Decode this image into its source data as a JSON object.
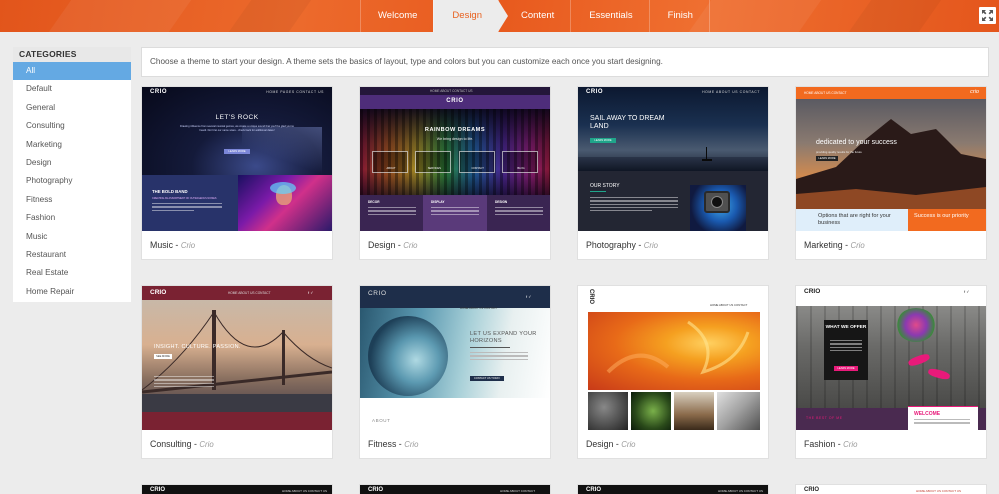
{
  "wizard": {
    "steps": [
      {
        "label": "Welcome",
        "active": false
      },
      {
        "label": "Design",
        "active": true
      },
      {
        "label": "Content",
        "active": false
      },
      {
        "label": "Essentials",
        "active": false
      },
      {
        "label": "Finish",
        "active": false
      }
    ]
  },
  "colors": {
    "accent": "#e8611f",
    "selection": "#64a9e3"
  },
  "sidebar": {
    "title": "CATEGORIES",
    "items": [
      "All",
      "Default",
      "General",
      "Consulting",
      "Marketing",
      "Design",
      "Photography",
      "Fitness",
      "Fashion",
      "Music",
      "Restaurant",
      "Real Estate",
      "Home Repair"
    ],
    "selected": "All"
  },
  "intro": "Choose a theme to start your design. A theme sets the basics of layout, type and colors but you can customize each once you start designing.",
  "themes": [
    {
      "name": "Music",
      "brand": "Crio",
      "preview": {
        "logo": "CRIO",
        "nav": "HOME   PAGES   CONTACT US",
        "headline": "LET'S ROCK",
        "sub": "Drawing influence from several musical genres, we create a unique sound that you'll be glad you've heard. Don't let our name scare - check back for additional dates!",
        "button": "LEARN MORE",
        "section": "THE BOLD BAND",
        "section_sub": "CREATING AN ASSORTMENT OF OUTRAGEOUS NOISES"
      }
    },
    {
      "name": "Design",
      "brand": "Crio",
      "preview": {
        "logo": "CRIO",
        "nav": "HOME   ABOUT   CONTACT US",
        "headline": "RAINBOW DREAMS",
        "sub": "We bring design to life.",
        "icons": [
          "ABOUT",
          "SERVICES",
          "CONTACT",
          "BLOG"
        ],
        "cols": [
          "DECOR",
          "DISPLAY",
          "DESIGN"
        ]
      }
    },
    {
      "name": "Photography",
      "brand": "Crio",
      "preview": {
        "logo": "CRIO",
        "nav": "HOME   ABOUT US   CONTACT",
        "headline": "SAIL AWAY TO DREAM LAND",
        "button": "LEARN MORE",
        "section": "OUR STORY"
      }
    },
    {
      "name": "Marketing",
      "brand": "Crio",
      "preview": {
        "logo": "crio",
        "nav": "HOME   ABOUT US   CONTACT",
        "headline": "dedicated to your success",
        "sub": "providing quality results for the future",
        "button": "LEARN MORE",
        "box_left": "Options that are right for your business",
        "box_right": "Success is our priority"
      }
    },
    {
      "name": "Consulting",
      "brand": "Crio",
      "preview": {
        "logo": "CRIO",
        "nav": "HOME   ABOUT US   CONTACT",
        "headline": "INSIGHT. CULTURE. PASSION.",
        "button": "SEE MORE"
      }
    },
    {
      "name": "Fitness",
      "brand": "Crio",
      "preview": {
        "logo": "CRIO",
        "nav": "HOME   ABOUT US   CONTACT",
        "headline": "LET US EXPAND YOUR HORIZONS",
        "button": "CONTACT US TODAY",
        "section": "ABOUT"
      }
    },
    {
      "name": "Design",
      "brand": "Crio",
      "preview": {
        "logo": "CRIO",
        "nav": "HOME   ABOUT US   CONTACT"
      }
    },
    {
      "name": "Fashion",
      "brand": "Crio",
      "preview": {
        "logo": "CRIO",
        "headline": "WHAT WE OFFER",
        "button": "LEARN MORE",
        "section": "WELCOME",
        "footer": "THE BEST OF ME"
      }
    }
  ],
  "bottom_row": [
    {
      "logo": "CRIO",
      "nav": "HOME   ABOUT US   CONTACT US"
    },
    {
      "logo": "CRIO",
      "nav": "HOME   ABOUT   CONTACT"
    },
    {
      "logo": "CRIO",
      "nav": "HOME   ABOUT US   CONTACT US"
    },
    {
      "logo": "CRIO",
      "nav": "HOME   ABOUT US   CONTACT US"
    }
  ]
}
